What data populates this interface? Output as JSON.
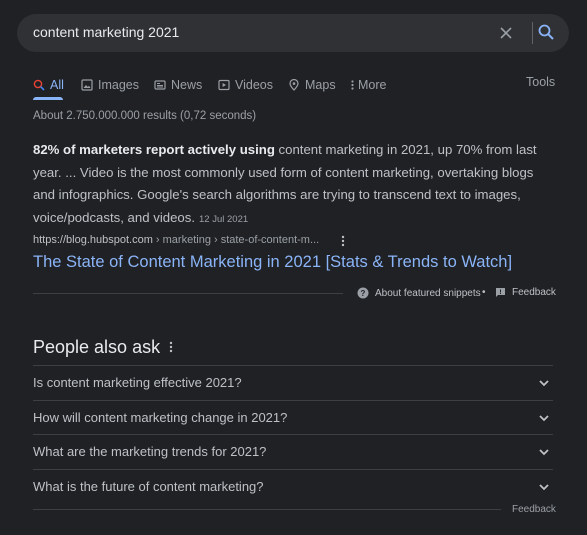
{
  "search": {
    "query": "content marketing 2021"
  },
  "tabs": [
    {
      "label": "All",
      "icon": "search-icon"
    },
    {
      "label": "Images",
      "icon": "image-icon"
    },
    {
      "label": "News",
      "icon": "news-icon"
    },
    {
      "label": "Videos",
      "icon": "video-icon"
    },
    {
      "label": "Maps",
      "icon": "map-pin-icon"
    },
    {
      "label": "More",
      "icon": "more-vert-icon"
    }
  ],
  "tools_label": "Tools",
  "results_count": "About 2.750.000.000 results (0,72 seconds)",
  "snippet": {
    "bold": "82% of marketers report actively using",
    "text": " content marketing in 2021, up 70% from last year. ... Video is the most commonly used form of content marketing, overtaking blogs and infographics. Google's search algorithms are trying to transcend text to images, voice/podcasts, and videos.",
    "date": "12 Jul 2021"
  },
  "result": {
    "domain": "https://blog.hubspot.com",
    "path": " › marketing › state-of-content-m...",
    "title": "The State of Content Marketing in 2021 [Stats & Trends to Watch]"
  },
  "snippet_footer": {
    "about": "About featured snippets",
    "separator": "•",
    "feedback": "Feedback"
  },
  "paa": {
    "title": "People also ask",
    "questions": [
      "Is content marketing effective 2021?",
      "How will content marketing change in 2021?",
      "What are the marketing trends for 2021?",
      "What is the future of content marketing?"
    ],
    "feedback": "Feedback"
  },
  "colors": {
    "background": "#202124",
    "searchbar": "#303134",
    "link": "#8ab4f8",
    "text": "#bdc1c6",
    "muted": "#9aa0a6"
  }
}
